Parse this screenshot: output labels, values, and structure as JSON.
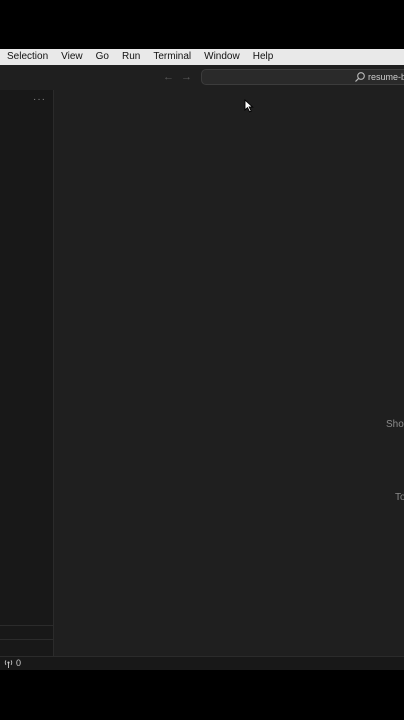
{
  "menubar": {
    "items": [
      "Selection",
      "View",
      "Go",
      "Run",
      "Terminal",
      "Window",
      "Help"
    ]
  },
  "titlebar": {
    "back_icon": "arrow-left-icon",
    "forward_icon": "arrow-right-icon",
    "command_center_label": "resume-b"
  },
  "sidebar": {
    "more_label": "···"
  },
  "editor": {
    "hint_show": "Sho",
    "hint_toggle": "To"
  },
  "statusbar": {
    "ports_count": "0"
  },
  "colors": {
    "editor_bg": "#1f1f1f",
    "sidebar_bg": "#181818",
    "menubar_bg": "#e9e9e9"
  }
}
